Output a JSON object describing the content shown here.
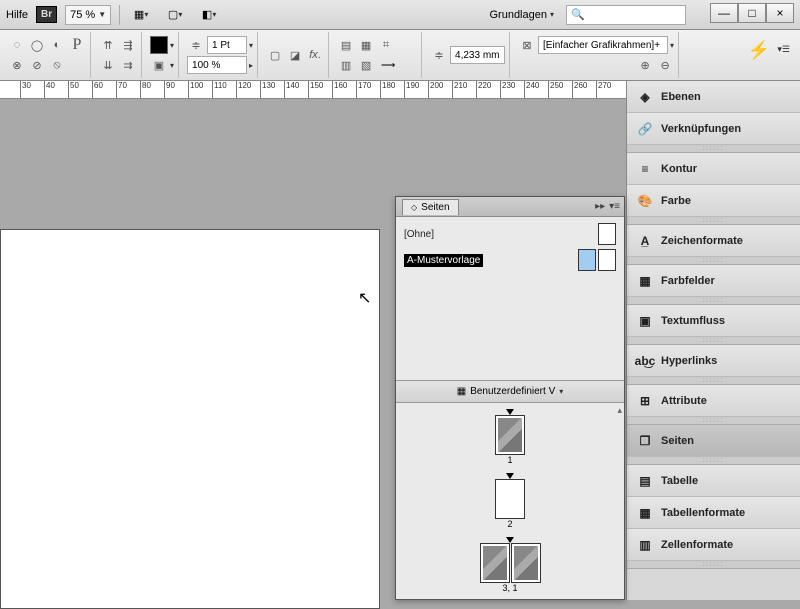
{
  "topbar": {
    "help": "Hilfe",
    "bridge_badge": "Br",
    "zoom": "75 %",
    "workspace_label": "Grundlagen",
    "search_placeholder": "🔍"
  },
  "window_controls": {
    "min": "—",
    "max": "□",
    "close": "×"
  },
  "toolrow": {
    "stroke_weight": "1 Pt",
    "opacity": "100 %",
    "measure": "4,233 mm",
    "frame_style": "[Einfacher Grafikrahmen]+"
  },
  "ruler": {
    "start": 30,
    "step": 10,
    "count": 25
  },
  "pages_panel": {
    "title": "Seiten",
    "masters": [
      {
        "label": "[Ohne]",
        "selected": false
      },
      {
        "label": "A-Mustervorlage",
        "selected": true
      }
    ],
    "spread_selector": "Benutzerdefiniert V",
    "pages": [
      {
        "label": "1",
        "thumb": "img",
        "single": true
      },
      {
        "label": "2",
        "thumb": "blank",
        "single": true
      },
      {
        "label": "3, 1",
        "thumb": "img",
        "single": false
      }
    ]
  },
  "right_dock": {
    "groups": [
      [
        {
          "icon": "◈",
          "label": "Ebenen",
          "name": "layers"
        },
        {
          "icon": "🔗",
          "label": "Verknüpfungen",
          "name": "links"
        }
      ],
      [
        {
          "icon": "≡",
          "label": "Kontur",
          "name": "stroke"
        },
        {
          "icon": "🎨",
          "label": "Farbe",
          "name": "color"
        }
      ],
      [
        {
          "icon": "A̲",
          "label": "Zeichenformate",
          "name": "char-styles"
        }
      ],
      [
        {
          "icon": "▦",
          "label": "Farbfelder",
          "name": "swatches"
        }
      ],
      [
        {
          "icon": "▣",
          "label": "Textumfluss",
          "name": "text-wrap"
        }
      ],
      [
        {
          "icon": "ab͜c",
          "label": "Hyperlinks",
          "name": "hyperlinks"
        }
      ],
      [
        {
          "icon": "⊞",
          "label": "Attribute",
          "name": "attributes"
        }
      ],
      [
        {
          "icon": "❐",
          "label": "Seiten",
          "name": "pages",
          "active": true
        }
      ],
      [
        {
          "icon": "▤",
          "label": "Tabelle",
          "name": "table"
        },
        {
          "icon": "▦",
          "label": "Tabellenformate",
          "name": "table-styles"
        },
        {
          "icon": "▥",
          "label": "Zellenformate",
          "name": "cell-styles"
        }
      ]
    ]
  }
}
